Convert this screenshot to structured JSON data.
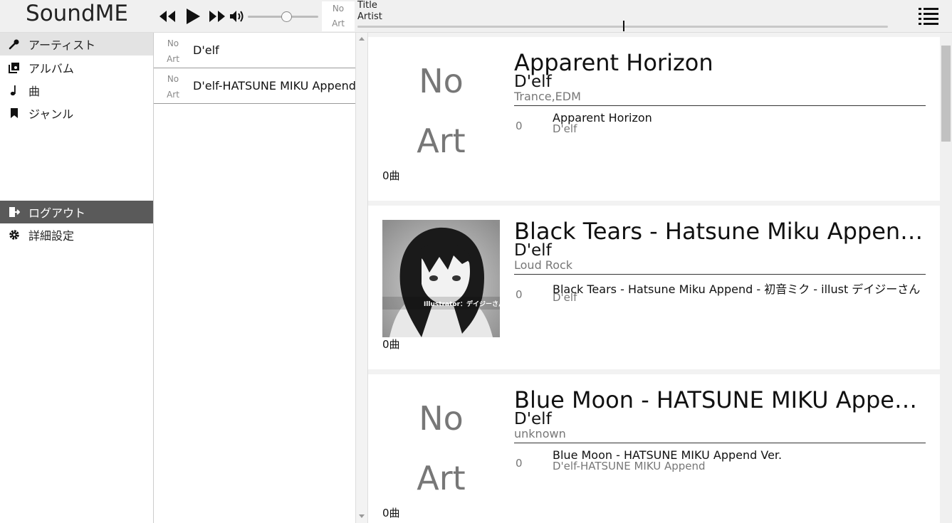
{
  "app": {
    "logo": "SoundME"
  },
  "player": {
    "mini_art": [
      "No",
      "Art"
    ],
    "now_playing_title": "Title",
    "now_playing_artist": "Artist",
    "volume": 0.55,
    "progress": 0.5,
    "icons": [
      "rewind-icon",
      "play-icon",
      "fast-forward-icon",
      "volume-icon",
      "menu-list-icon"
    ]
  },
  "sidebar": {
    "items": [
      {
        "label": "アーティスト",
        "icon": "microphone-icon"
      },
      {
        "label": "アルバム",
        "icon": "album-icon"
      },
      {
        "label": "曲",
        "icon": "music-note-icon"
      },
      {
        "label": "ジャンル",
        "icon": "bookmark-icon"
      }
    ],
    "bottom": [
      {
        "label": "ログアウト",
        "icon": "logout-icon"
      },
      {
        "label": "詳細設定",
        "icon": "gear-icon"
      }
    ]
  },
  "artists": [
    {
      "art": [
        "No",
        "Art"
      ],
      "name": "D'elf"
    },
    {
      "art": [
        "No",
        "Art"
      ],
      "name": "D'elf-HATSUNE MIKU Append"
    }
  ],
  "albums": [
    {
      "cover": [
        "No",
        "Art"
      ],
      "title": "Apparent Horizon",
      "artist": "D'elf",
      "genre": "Trance,EDM",
      "count": "0曲",
      "tracks": [
        {
          "num": "0",
          "title": "Apparent Horizon",
          "artist": "D'elf"
        }
      ]
    },
    {
      "cover_image": "illustration-dark-haired-girl",
      "cover_caption": "Illustrator：デイジーさん",
      "title": "Black Tears - Hatsune Miku Append - 初音ミク - illust デイジーさん",
      "artist": "D'elf",
      "genre": "Loud Rock",
      "count": "0曲",
      "tracks": [
        {
          "num": "0",
          "title": "Black Tears - Hatsune Miku Append - 初音ミク - illust デイジーさん",
          "artist": "D'elf"
        }
      ]
    },
    {
      "cover": [
        "No",
        "Art"
      ],
      "title": "Blue Moon - HATSUNE MIKU Append Ver.",
      "artist": "D'elf",
      "genre": "unknown",
      "count": "0曲",
      "tracks": [
        {
          "num": "0",
          "title": "Blue Moon - HATSUNE MIKU Append Ver.",
          "artist": "D'elf-HATSUNE MIKU Append"
        }
      ]
    }
  ]
}
